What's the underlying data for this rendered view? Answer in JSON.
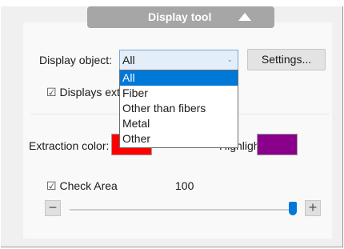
{
  "header": {
    "title": "Display tool"
  },
  "display_object": {
    "label": "Display object:",
    "selected": "All",
    "options": [
      "All",
      "Fiber",
      "Other than fibers",
      "Metal",
      "Other"
    ]
  },
  "settings_button": "Settings...",
  "displays_extra": {
    "label": "Displays extra",
    "checked": true
  },
  "extraction_color": {
    "label": "Extraction color:",
    "color": "#ff0000"
  },
  "highlight": {
    "label": "Highlight:",
    "label_visible": "Highlight:",
    "color": "#8b008b"
  },
  "check_area": {
    "label": "Check Area",
    "checked": true,
    "value": "100",
    "level_fraction": 1.0
  },
  "slider": {
    "minus": "−",
    "plus": "+"
  },
  "colors": {
    "accent": "#0078d7",
    "header_bg": "#a6a6a6"
  }
}
